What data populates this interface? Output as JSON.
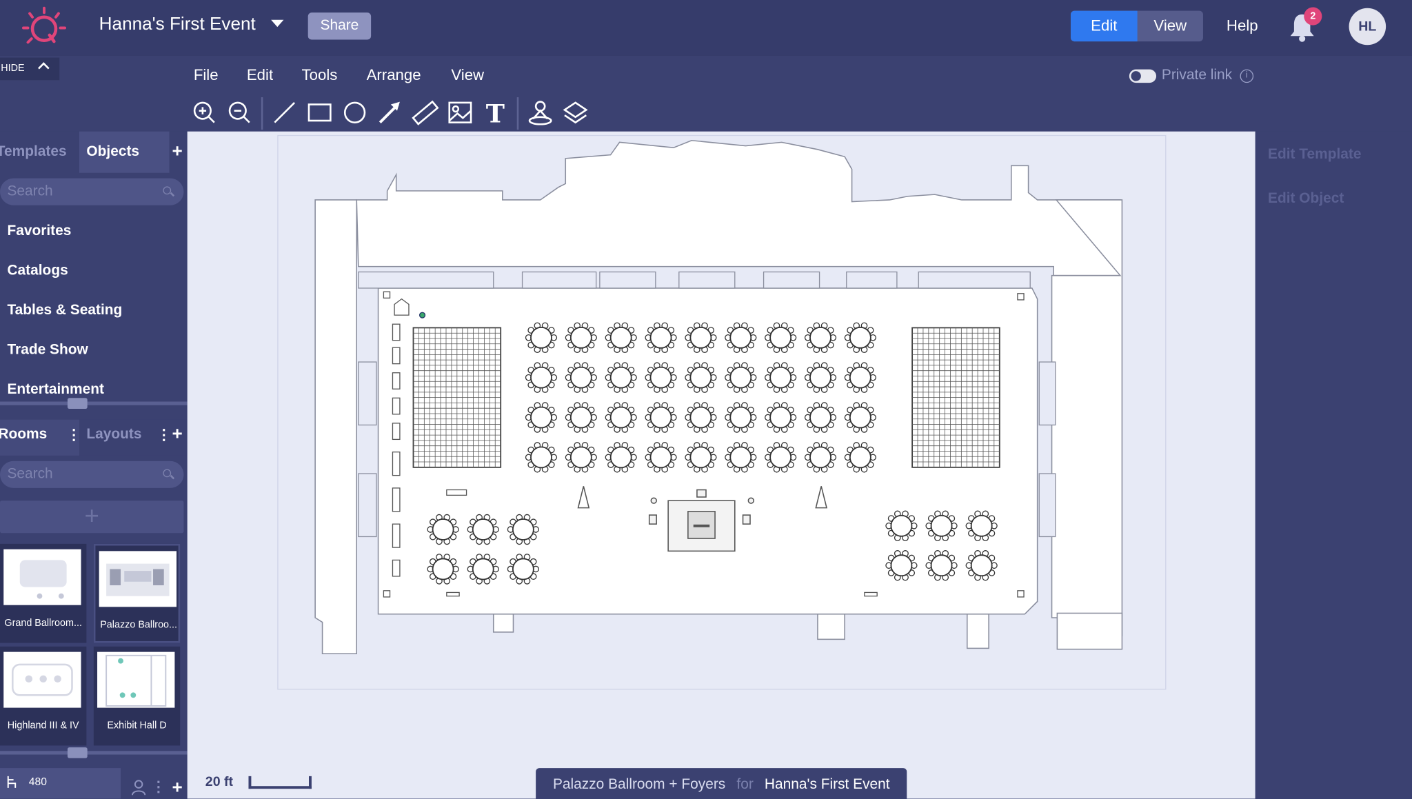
{
  "header": {
    "event_title": "Hanna's First Event",
    "share_label": "Share",
    "edit_label": "Edit",
    "view_label": "View",
    "help_label": "Help",
    "notification_count": "2",
    "avatar_initials": "HL",
    "accent_color": "#2f79ef",
    "brand_color": "#e0457a"
  },
  "hide_label": "HIDE",
  "menu": [
    "File",
    "Edit",
    "Tools",
    "Arrange",
    "View"
  ],
  "private_link_label": "Private link",
  "toolbar_icons": [
    "zoom-in-icon",
    "zoom-out-icon",
    "line-icon",
    "rectangle-icon",
    "circle-icon",
    "arrow-icon",
    "ruler-icon",
    "image-icon",
    "text-icon",
    "person-pin-icon",
    "layers-icon"
  ],
  "sidebar": {
    "tabs": [
      "Templates",
      "Objects"
    ],
    "search_placeholder": "Search",
    "categories": [
      "Favorites",
      "Catalogs",
      "Tables & Seating",
      "Trade Show",
      "Entertainment"
    ],
    "rooms_tab": "Rooms",
    "layouts_tab": "Layouts",
    "rooms": [
      "Grand Ballroom...",
      "Palazzo Ballroo...",
      "Highland III & IV",
      "Exhibit Hall D"
    ],
    "capacity": "480"
  },
  "right_panel": {
    "edit_template": "Edit Template",
    "edit_object": "Edit Object"
  },
  "scale_label": "20 ft",
  "footer": {
    "room": "Palazzo Ballroom + Foyers",
    "for": "for",
    "event": "Hanna's First Event"
  }
}
